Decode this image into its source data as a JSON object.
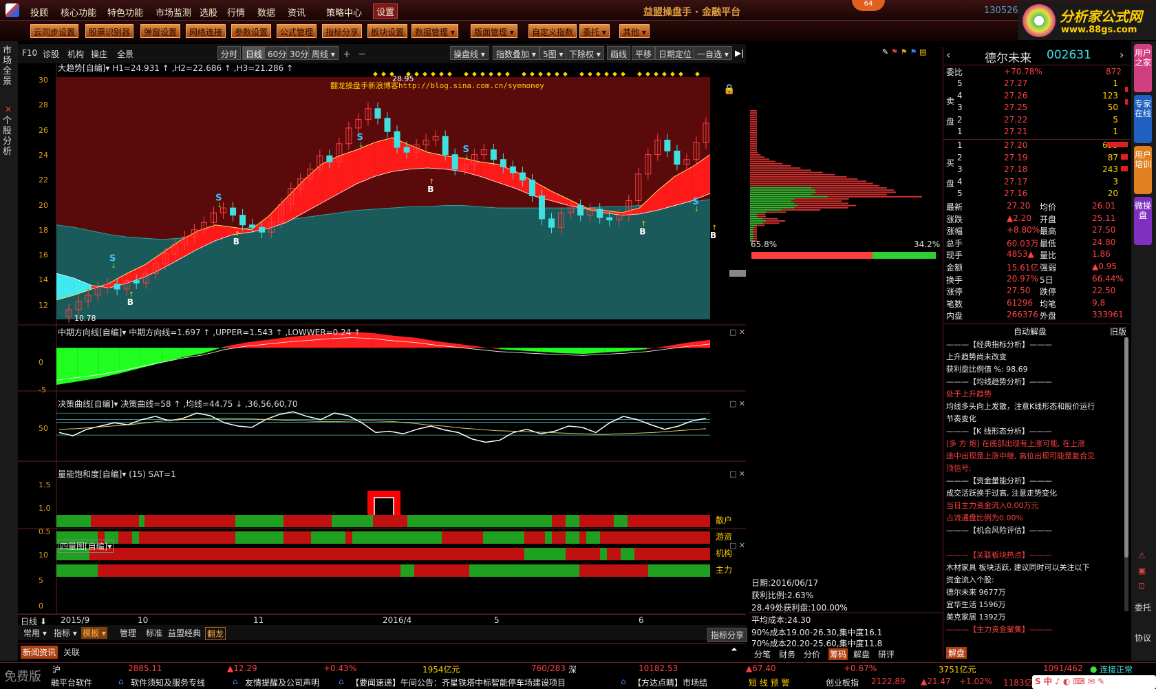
{
  "menu": {
    "items": [
      "投顾",
      "核心功能",
      "特色功能",
      "市场监测",
      "选股",
      "行情",
      "数据",
      "资讯",
      "策略中心",
      "设置"
    ],
    "active": "设置"
  },
  "app": {
    "title": "益盟操盘手 · 金融平台",
    "user_code": "130526",
    "badge": "64"
  },
  "logo": {
    "line1": "分析家公式网",
    "line2": "www.88gs.com"
  },
  "toolbar": [
    "云同步设置",
    "股票识别器",
    "弹窗设置",
    "网络连接",
    "参数设置",
    "公式管理",
    "指标分享",
    "板块设置",
    "数据管理 ▾",
    "版面管理 ▾",
    "自定义指数",
    "委托 ▾",
    "其他 ▾"
  ],
  "left_strip": {
    "tab1": "市场全景",
    "tab2": "个股分析"
  },
  "chart_toolbar": {
    "left": [
      "F10",
      "诊股",
      "机构",
      "操庄",
      "全景"
    ],
    "periods": [
      "分时",
      "日线",
      "60分",
      "30分",
      "周线 ▾"
    ],
    "period_selected": "日线",
    "zoom": [
      "＋",
      "－"
    ],
    "right": [
      "操盘线 ▾",
      "指数叠加 ▾",
      "5图 ▾",
      "下除权 ▾",
      "画线",
      "平移",
      "日期定位",
      "一自选 ▾"
    ]
  },
  "main_panel": {
    "header": "大趋势[自编]▾  H1=24.931 ↑ ,H2=22.686 ↑ ,H3=21.286 ↑",
    "watermark": "翻龙操盘手新浪博客http://blog.sina.com.cn/syemoney",
    "low_label": "10.78",
    "high_label": "28.95",
    "y_ticks": [
      "30",
      "28",
      "26",
      "24",
      "22",
      "20",
      "18",
      "16",
      "14",
      "12"
    ]
  },
  "panel2": {
    "header": "中期方向线[自编]▾  中期方向线=1.697 ↑ ,UPPER=1.543 ↑ ,LOWWER=0.24 ↑",
    "y_ticks": [
      "0",
      "-5"
    ]
  },
  "panel3": {
    "header": "决策曲线[自编]▾  决策曲线=58 ↑ ,均线=44.75 ↓ ,36,56,60,70",
    "y_ticks": [
      "50"
    ]
  },
  "panel4": {
    "header": "量能饱和度[自编]▾  (15)  SAT=1",
    "y_ticks": [
      "1.5",
      "1.0",
      "0.5"
    ]
  },
  "panel5": {
    "header": "四量图[自编]▾",
    "rows": [
      "散户",
      "游资",
      "机构",
      "主力"
    ],
    "y_ticks": [
      "10",
      "5",
      "0"
    ]
  },
  "x_axis": {
    "period": "日线 ⬇",
    "labels": [
      "2015/9",
      "10",
      "11",
      "2016/4",
      "5",
      "6"
    ]
  },
  "bottom_tabs": [
    "常用 ▾",
    "指标 ▾",
    "模板 ▾",
    "管理",
    "标准",
    "益盟经典",
    "翻龙"
  ],
  "bottom_right": "指标分享",
  "news_tabs": [
    "新闻资讯",
    "关联"
  ],
  "chip": {
    "left_pct": "65.8%",
    "right_pct": "34.2%",
    "date": "日期:2016/06/17",
    "profit_ratio": "获利比例:2.63%",
    "profit_line": "28.49处获利盘:100.00%",
    "avg_cost": "平均成本:24.30",
    "c90": "90%成本19.00-26.30,集中度16.1",
    "c70": "70%成本20.20-25.60,集中度11.8",
    "tabs": [
      "分笔",
      "财务",
      "分价",
      "筹码",
      "解盘",
      "研评"
    ],
    "tab_selected": "筹码"
  },
  "stock": {
    "name": "德尔未来",
    "code": "002631",
    "weibi_label": "委比",
    "weibi": "+70.78%",
    "weibi_diff": "872",
    "sell": [
      {
        "n": "5",
        "p": "27.27",
        "v": "1"
      },
      {
        "n": "4",
        "p": "27.26",
        "v": "123"
      },
      {
        "n": "3",
        "p": "27.25",
        "v": "50"
      },
      {
        "n": "2",
        "p": "27.22",
        "v": "5"
      },
      {
        "n": "1",
        "p": "27.21",
        "v": "1"
      }
    ],
    "buy": [
      {
        "n": "1",
        "p": "27.20",
        "v": "699"
      },
      {
        "n": "2",
        "p": "27.19",
        "v": "87"
      },
      {
        "n": "3",
        "p": "27.18",
        "v": "243"
      },
      {
        "n": "4",
        "p": "27.17",
        "v": "3"
      },
      {
        "n": "5",
        "p": "27.16",
        "v": "20"
      }
    ],
    "sell_label": "卖盘",
    "buy_label": "买盘",
    "quotes": [
      [
        "最新",
        "27.20",
        "均价",
        "26.01"
      ],
      [
        "涨跌",
        "▲2.20",
        "开盘",
        "25.11"
      ],
      [
        "涨幅",
        "+8.80%",
        "最高",
        "27.50"
      ],
      [
        "总手",
        "60.03万",
        "最低",
        "24.80"
      ],
      [
        "现手",
        "4853▲",
        "量比",
        "1.86"
      ],
      [
        "金额",
        "15.61亿",
        "强弱",
        "▲0.95"
      ],
      [
        "换手",
        "20.97%",
        "5日",
        "66.44%"
      ],
      [
        "涨停",
        "27.50",
        "跌停",
        "22.50"
      ],
      [
        "笔数",
        "61296",
        "均笔",
        "9.8"
      ],
      [
        "内盘",
        "266376",
        "外盘",
        "333961"
      ]
    ]
  },
  "analysis": {
    "title": "自动解盘",
    "old": "旧版",
    "lines": [
      {
        "t": "———【经典指标分析】———",
        "c": "wht"
      },
      {
        "t": "上升趋势尚未改变",
        "c": "wht"
      },
      {
        "t": "获利盘比例值 %: 98.69",
        "c": "wht"
      },
      {
        "t": "———【均线趋势分析】———",
        "c": "wht"
      },
      {
        "t": "处于上升趋势",
        "c": "red"
      },
      {
        "t": "均线多头向上发散，注意K线形态和股价运行",
        "c": "wht"
      },
      {
        "t": "节奏变化",
        "c": "wht"
      },
      {
        "t": "———【K 线形态分析】———",
        "c": "wht"
      },
      {
        "t": "[多 方 炮] 在底部出现有上涨可能, 在上涨",
        "c": "red"
      },
      {
        "t": "途中出现是上涨中继, 高位出现可能是复合见",
        "c": "red"
      },
      {
        "t": "顶信号;",
        "c": "red"
      },
      {
        "t": "———【资金量能分析】———",
        "c": "wht"
      },
      {
        "t": "成交活跃换手过高, 注意走势变化",
        "c": "wht"
      },
      {
        "t": "当日主力资金流入0.00万元",
        "c": "red"
      },
      {
        "t": "占流通盘比例为0.00%",
        "c": "red"
      },
      {
        "t": "———【机会风险评估】———",
        "c": "wht"
      },
      {
        "t": "",
        "c": "wht"
      },
      {
        "t": "———【关联板块热点】———",
        "c": "red"
      },
      {
        "t": "木材家具  板块活跃, 建议同时可以关注以下",
        "c": "wht"
      },
      {
        "t": "资金流入个股:",
        "c": "wht"
      },
      {
        "t": "德尔未来  9677万",
        "c": "wht"
      },
      {
        "t": "宜华生活  1596万",
        "c": "wht"
      },
      {
        "t": "美克家居  1392万",
        "c": "wht"
      },
      {
        "t": "———【主力资金聚集】———",
        "c": "red"
      }
    ],
    "bottom_tab": "解盘"
  },
  "right_tabs": [
    "用户之家",
    "专家在线",
    "用户培训",
    "微操盘"
  ],
  "right_tools": [
    "委托",
    "协议"
  ],
  "status": {
    "free": "免费版",
    "sh_label": "沪",
    "sh": "2885.11",
    "sh_chg": "▲12.29",
    "sh_pct": "+0.43%",
    "sh_amt": "1954亿元",
    "ud": "760/283",
    "sz_label": "深",
    "sz": "10182.53",
    "sz_chg": "▲67.40",
    "sz_pct": "+0.67%",
    "sz_amt": "3751亿元",
    "ud2": "1091/462",
    "conn": "连接正常",
    "ticker": [
      "融平台软件",
      "软件须知及服务专线",
      "友情提醒及公司声明",
      "【要闻速递】午间公告：齐星铁塔中标智能停车场建设项目",
      "【方达点睛】市场结"
    ],
    "alert": "短 线 预 警",
    "cy_label": "创业板指",
    "cy": "2122.89",
    "cy_chg": "▲21.47",
    "cy_pct": "+1.02%",
    "cy_amt": "1183亿"
  },
  "chart_data": [
    {
      "type": "line",
      "title": "大趋势[自编]",
      "ylim": [
        11,
        31
      ],
      "series": [
        {
          "name": "H1",
          "last": 24.931
        },
        {
          "name": "H2",
          "last": 22.686
        },
        {
          "name": "H3",
          "last": 21.286
        }
      ],
      "price": [
        11.2,
        11.8,
        12.5,
        13.0,
        13.6,
        13.9,
        13.5,
        14.2,
        14.0,
        14.8,
        15.6,
        16.4,
        17.2,
        17.8,
        18.4,
        19.0,
        19.8,
        20.2,
        19.6,
        18.8,
        18.6,
        18.2,
        19.0,
        20.5,
        21.8,
        22.6,
        23.4,
        24.5,
        24.0,
        25.5,
        26.8,
        27.5,
        28.4,
        27.6,
        26.5,
        25.2,
        24.8,
        25.4,
        25.8,
        26.1,
        24.6,
        23.4,
        23.8,
        24.6,
        25.0,
        24.2,
        23.6,
        23.1,
        22.5,
        21.2,
        19.3,
        18.6,
        19.8,
        20.4,
        19.6,
        20.1,
        19.4,
        19.2,
        19.6,
        20.8,
        23.0,
        24.6,
        25.8,
        24.9,
        23.8,
        24.2,
        25.6,
        27.2
      ],
      "trend_upper": [
        12.6,
        13.0,
        13.5,
        14.0,
        14.8,
        15.5,
        16.5,
        17.5,
        18.3,
        18.8,
        18.6,
        18.4,
        19.5,
        21.0,
        22.5,
        23.8,
        24.5,
        25.0,
        25.6,
        26.0,
        25.4,
        24.8,
        24.5,
        24.3,
        24.0,
        23.8,
        23.2,
        22.4,
        21.6,
        20.9,
        20.2,
        20.0,
        19.8,
        20.2,
        21.6,
        22.8,
        23.6,
        24.6
      ],
      "trend_lower": [
        14.8,
        14.4,
        13.8,
        13.6,
        14.0,
        14.5,
        15.2,
        16.0,
        16.8,
        17.5,
        18.0,
        18.2,
        18.5,
        19.0,
        19.8,
        20.6,
        21.4,
        22.2,
        22.8,
        23.2,
        23.4,
        23.5,
        23.4,
        23.2,
        22.8,
        22.3,
        21.8,
        21.2,
        20.8,
        20.4,
        20.1,
        19.8,
        19.6,
        19.7,
        20.0,
        20.4,
        20.8,
        21.4
      ],
      "baseline": [
        18.8,
        18.6,
        18.3,
        18.0,
        17.8,
        17.7,
        17.6,
        17.7,
        17.8,
        18.0,
        18.3,
        18.6,
        18.9,
        19.2,
        19.4,
        19.6,
        19.8,
        20.0,
        20.1,
        20.2,
        20.3,
        20.3,
        20.4,
        20.4,
        20.3,
        20.2,
        20.2,
        20.2,
        20.2,
        20.2,
        20.2,
        20.3,
        20.3,
        20.4,
        20.5,
        20.6,
        20.7,
        20.9
      ],
      "signals_B": [
        [
          4,
          13.0
        ],
        [
          10,
          18.0
        ],
        [
          21,
          22.3
        ],
        [
          33,
          18.8
        ],
        [
          37,
          18.5
        ],
        [
          41,
          21.8
        ]
      ],
      "signals_S": [
        [
          3,
          15.8
        ],
        [
          9,
          20.8
        ],
        [
          17,
          25.8
        ],
        [
          23,
          24.8
        ],
        [
          36,
          20.5
        ],
        [
          40,
          26.0
        ]
      ]
    },
    {
      "type": "area",
      "title": "中期方向线[自编]",
      "ylim": [
        -6,
        3
      ],
      "values": [
        -5.5,
        -5.0,
        -4.5,
        -3.8,
        -3.0,
        -2.2,
        -1.4,
        -0.8,
        0.2,
        0.8,
        1.2,
        1.6,
        1.9,
        2.2,
        2.4,
        2.2,
        1.8,
        1.5,
        1.0,
        0.6,
        0.2,
        -0.2,
        -0.4,
        -0.6,
        -0.8,
        -0.9,
        -0.7,
        -0.5,
        -0.2,
        0.3,
        0.8,
        1.2
      ]
    },
    {
      "type": "line",
      "title": "决策曲线[自编]",
      "ylim": [
        0,
        100
      ],
      "values": [
        40,
        35,
        45,
        50,
        55,
        52,
        60,
        65,
        58,
        62,
        70,
        66,
        55,
        50,
        48,
        60,
        68,
        72,
        65,
        60,
        70,
        66,
        55,
        40,
        42,
        38,
        45,
        50,
        44,
        40,
        30,
        25,
        28,
        40,
        45,
        38,
        42,
        50,
        48,
        40,
        55,
        65,
        60,
        52,
        45,
        50,
        58,
        62
      ],
      "ma": [
        45,
        46,
        48,
        50,
        52,
        55,
        58,
        60,
        61,
        62,
        62,
        61,
        60,
        59,
        58,
        57,
        57,
        58,
        58,
        57,
        55,
        52,
        50,
        47,
        45,
        43,
        42,
        41,
        40,
        39,
        38,
        37,
        38,
        39,
        40,
        42,
        44,
        46
      ]
    },
    {
      "type": "bar",
      "title": "量能饱和度[自编]",
      "ylim": [
        0,
        1.5
      ],
      "values": [
        1
      ]
    },
    {
      "type": "heatmap",
      "title": "四量图[自编]",
      "rows": [
        "散户",
        "游资",
        "机构",
        "主力"
      ]
    }
  ]
}
